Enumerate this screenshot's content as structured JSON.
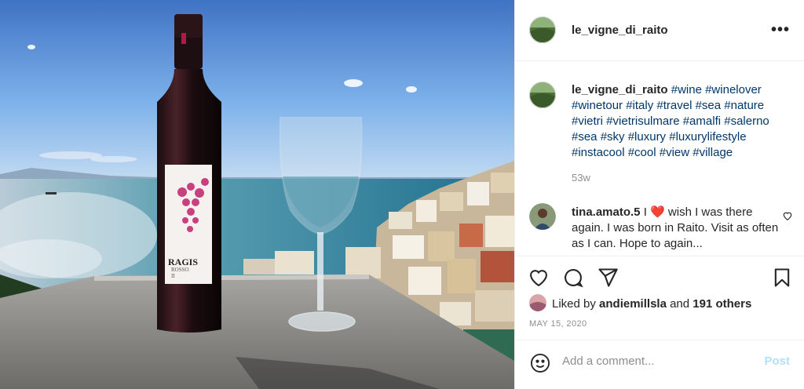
{
  "post": {
    "username": "le_vigne_di_raito",
    "more_icon": "more-horizontal-icon",
    "caption_hashtags": "#wine #winelover #winetour #italy #travel #sea #nature #vietri #vietrisulmare #amalfi #salerno #sea #sky #luxury #luxurylifestyle #instacool #cool #view #village",
    "age": "53w",
    "wine_label": {
      "brand": "RAGIS",
      "line1": "ROSSO",
      "line2": "II"
    }
  },
  "comment": {
    "username": "tina.amato.5",
    "text_before_emoji": " I ",
    "emoji": "❤️",
    "text_after_emoji": " wish I was there again. I was born in Raito. Visit as often as I can. Hope to again..."
  },
  "likes": {
    "prefix": "Liked by ",
    "user": "andiemillsla",
    "middle": " and ",
    "count": "191 others"
  },
  "date": "MAY 15, 2020",
  "comment_box": {
    "placeholder": "Add a comment...",
    "post_label": "Post"
  },
  "colors": {
    "link_blue": "#00376b",
    "post_disabled": "#b2dffc",
    "secondary_text": "#8e8e8e",
    "heart_red": "#ed4956"
  }
}
